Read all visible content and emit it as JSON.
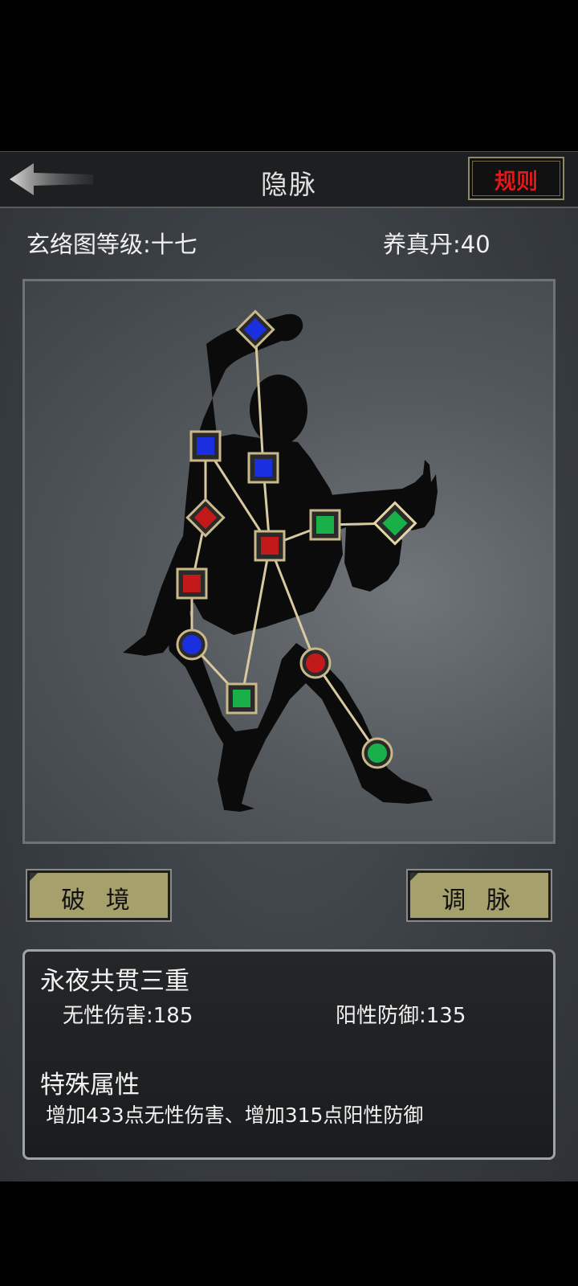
{
  "header": {
    "title": "隐脉",
    "rules_label": "规则"
  },
  "stats": {
    "level_text": "玄络图等级:十七",
    "pill_text": "养真丹:40"
  },
  "buttons": {
    "break_label": "破 境",
    "adjust_label": "调 脉"
  },
  "info": {
    "name": "永夜共贯三重",
    "attr_left": "无性伤害:185",
    "attr_right": "阳性防御:135",
    "special_title": "特殊属性",
    "special_text": "增加433点无性伤害、增加315点阳性防御"
  },
  "colors": {
    "blue": "#1a2fe0",
    "red": "#c21a1a",
    "green": "#19b04a",
    "border": "#c9b98a"
  },
  "meridian_nodes": [
    {
      "id": "n-top",
      "shape": "diamond",
      "color": "blue"
    },
    {
      "id": "n-left-shoulder",
      "shape": "square",
      "color": "blue"
    },
    {
      "id": "n-neck",
      "shape": "square",
      "color": "blue"
    },
    {
      "id": "n-left-chest",
      "shape": "diamond",
      "color": "red"
    },
    {
      "id": "n-center",
      "shape": "square",
      "color": "red"
    },
    {
      "id": "n-right-arm",
      "shape": "square",
      "color": "green"
    },
    {
      "id": "n-right-hand",
      "shape": "diamond",
      "color": "green"
    },
    {
      "id": "n-left-waist",
      "shape": "square",
      "color": "red"
    },
    {
      "id": "n-left-hip",
      "shape": "circle",
      "color": "blue"
    },
    {
      "id": "n-right-knee",
      "shape": "circle",
      "color": "red"
    },
    {
      "id": "n-left-knee",
      "shape": "square",
      "color": "green"
    },
    {
      "id": "n-right-foot",
      "shape": "circle",
      "color": "green"
    }
  ]
}
